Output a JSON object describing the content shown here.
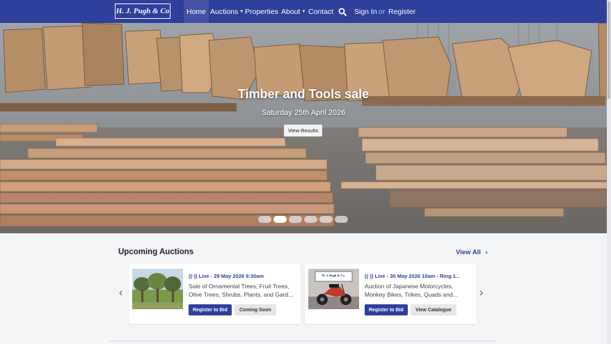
{
  "brand": {
    "logo_text": "H. J. Pugh & Co"
  },
  "nav": {
    "items": [
      {
        "label": "Home"
      },
      {
        "label": "Auctions",
        "has_dropdown": true
      },
      {
        "label": "Properties"
      },
      {
        "label": "About",
        "has_dropdown": true
      },
      {
        "label": "Contact"
      }
    ],
    "search_icon": "search-icon",
    "sign_in": "Sign In",
    "or": "or",
    "register": "Register"
  },
  "hero": {
    "title": "Timber and Tools sale",
    "subtitle": "Saturday 25th April 2026",
    "button": "View Results",
    "slide_count": 6,
    "active_slide": 2
  },
  "upcoming": {
    "title": "Upcoming Auctions",
    "view_all": "View All",
    "cards": [
      {
        "live": "Live - 29 May 2026 9:30am",
        "description": "Sale of Ornamental Trees, Fruit Trees, Olive Trees, Shrubs, Plants, and Gard...",
        "primary_btn": "Register to Bid",
        "secondary_btn": "Coming Soon"
      },
      {
        "live": "Live - 30 May 2026 10am - Ring 1...",
        "description": "Auction of Japanese Motorcycles, Monkey Bikes, Trikes, Quads and...",
        "primary_btn": "Register to Bid",
        "secondary_btn": "View Catalogue",
        "image_sign": "H. J. Pugh & Co."
      }
    ]
  },
  "colors": {
    "brand_blue": "#2e3f9c",
    "background": "#f4f5f7"
  }
}
